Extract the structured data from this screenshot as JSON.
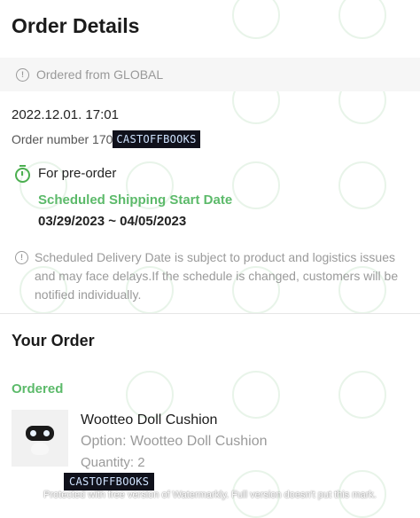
{
  "page": {
    "title": "Order Details"
  },
  "origin": {
    "icon": "info-icon",
    "text": "Ordered from GLOBAL"
  },
  "order": {
    "date": "2022.12.01. 17:01",
    "number_prefix": "Order number 170",
    "number_redaction": "CASTOFFBOOKS"
  },
  "preorder": {
    "icon": "clock-icon",
    "label": "For pre-order",
    "shipping_label": "Scheduled Shipping Start Date",
    "shipping_dates": "03/29/2023 ~ 04/05/2023"
  },
  "notice": {
    "icon": "info-icon",
    "text": "Scheduled Delivery Date is subject to product and logistics issues and may face delays.If the schedule is changed, customers will be notified individually."
  },
  "your_order": {
    "heading": "Your Order",
    "status": "Ordered",
    "item": {
      "name": "Wootteo Doll Cushion",
      "option": "Option: Wootteo Doll Cushion",
      "quantity": "Quantity: 2"
    }
  },
  "watermark": {
    "redaction": "CASTOFFBOOKS",
    "note": "Protected with free version of Watermarkly. Full version doesn't put this mark."
  },
  "colors": {
    "accent_green": "#5cba6a",
    "muted_text": "#9a9a9a",
    "redaction_bg": "#10111b"
  }
}
